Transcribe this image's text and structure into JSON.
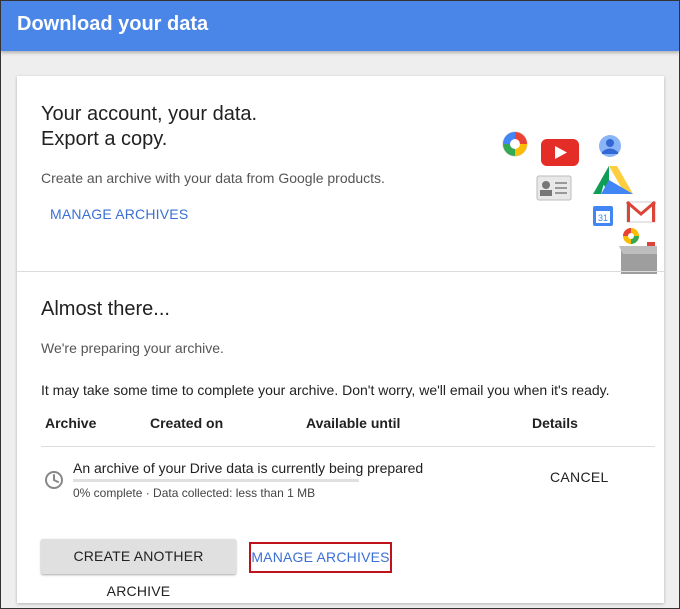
{
  "header": {
    "title": "Download your data"
  },
  "intro": {
    "headline_line1": "Your account, your data.",
    "headline_line2": "Export a copy.",
    "description": "Create an archive with your data from Google products.",
    "manage_link": "MANAGE ARCHIVES"
  },
  "status": {
    "title": "Almost there...",
    "preparing": "We're preparing your archive.",
    "note": "It may take some time to complete your archive. Don't worry, we'll email you when it's ready.",
    "columns": [
      "Archive",
      "Created on",
      "Available until",
      "Details"
    ],
    "row": {
      "description": "An archive of your Drive data is currently being prepared",
      "progress_percent": 0,
      "progress_text": "0% complete · Data collected: less than 1 MB",
      "cancel_label": "CANCEL"
    },
    "create_another_label": "CREATE ANOTHER ARCHIVE",
    "manage_link": "MANAGE ARCHIVES"
  },
  "illustration": {
    "icons": [
      "picasa-icon",
      "youtube-icon",
      "profile-icon",
      "contacts-icon",
      "drive-icon",
      "calendar-icon",
      "gmail-icon",
      "hangouts-icon",
      "box-icon"
    ],
    "calendar_day": "31"
  },
  "colors": {
    "accent": "#4a86e8",
    "link": "#3b6fd6",
    "highlight": "#c0121b"
  }
}
